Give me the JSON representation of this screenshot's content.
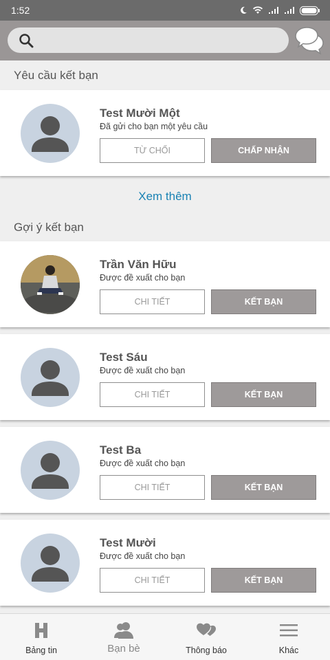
{
  "status": {
    "time": "1:52"
  },
  "search": {
    "placeholder": ""
  },
  "friend_requests": {
    "title": "Yêu cầu kết bạn",
    "items": [
      {
        "name": "Test Mười Một",
        "subtitle": "Đã gửi cho bạn một yêu cầu",
        "decline_label": "TỪ CHỐI",
        "accept_label": "CHẤP NHẬN"
      }
    ],
    "see_more": "Xem thêm"
  },
  "suggestions": {
    "title": "Gợi ý kết bạn",
    "items": [
      {
        "name": "Trần Văn Hữu",
        "subtitle": "Được đề xuất cho bạn",
        "detail_label": "CHI TIẾT",
        "add_label": "KẾT BẠN",
        "avatar": "photo"
      },
      {
        "name": "Test Sáu",
        "subtitle": "Được đề xuất cho bạn",
        "detail_label": "CHI TIẾT",
        "add_label": "KẾT BẠN",
        "avatar": "placeholder"
      },
      {
        "name": "Test Ba",
        "subtitle": "Được đề xuất cho bạn",
        "detail_label": "CHI TIẾT",
        "add_label": "KẾT BẠN",
        "avatar": "placeholder"
      },
      {
        "name": "Test Mười",
        "subtitle": "Được đề xuất cho bạn",
        "detail_label": "CHI TIẾT",
        "add_label": "KẾT BẠN",
        "avatar": "placeholder"
      }
    ]
  },
  "bottom_nav": [
    {
      "label": "Bảng tin",
      "icon": "home-icon"
    },
    {
      "label": "Bạn bè",
      "icon": "friends-icon"
    },
    {
      "label": "Thông báo",
      "icon": "notifications-icon"
    },
    {
      "label": "Khác",
      "icon": "menu-icon"
    }
  ],
  "colors": {
    "topbar": "#9a9696",
    "button_fill": "#9e9a9a",
    "link": "#1a82b4",
    "avatar_bg": "#c8d3e0"
  }
}
